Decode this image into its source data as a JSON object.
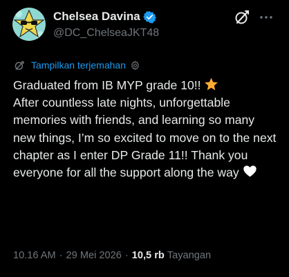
{
  "author": {
    "display_name": "Chelsea Davina",
    "handle": "@DC_ChelseaJKT48",
    "verified": true,
    "avatar_icon": "star-sunglasses-avatar",
    "verified_color": "#1d9bf0"
  },
  "header_actions": {
    "grok_icon": "grok-icon",
    "more_icon": "more-dots-icon"
  },
  "translate": {
    "label": "Tampilkan terjemahan",
    "icon": "translate-icon",
    "settings_icon": "gear-icon"
  },
  "post": {
    "line_1": "Graduated from IB MYP grade 10!! ",
    "star_emoji": "⭐",
    "line_rest": "After countless late nights, unforgettable memories with friends, and learning so many new things, I’m so excited to move on to the next chapter as I enter DP Grade 11!! Thank you everyone for all the support along the way ",
    "heart_emoji": "🤍"
  },
  "meta": {
    "time": "10.16 AM",
    "separator_1": "·",
    "date": "29 Mei 2026",
    "separator_2": "·",
    "views_count": "10,5 rb",
    "views_label": "Tayangan"
  },
  "colors": {
    "background": "#000000",
    "text_primary": "#e7e9ea",
    "text_secondary": "#71767b",
    "accent": "#1d9bf0"
  }
}
